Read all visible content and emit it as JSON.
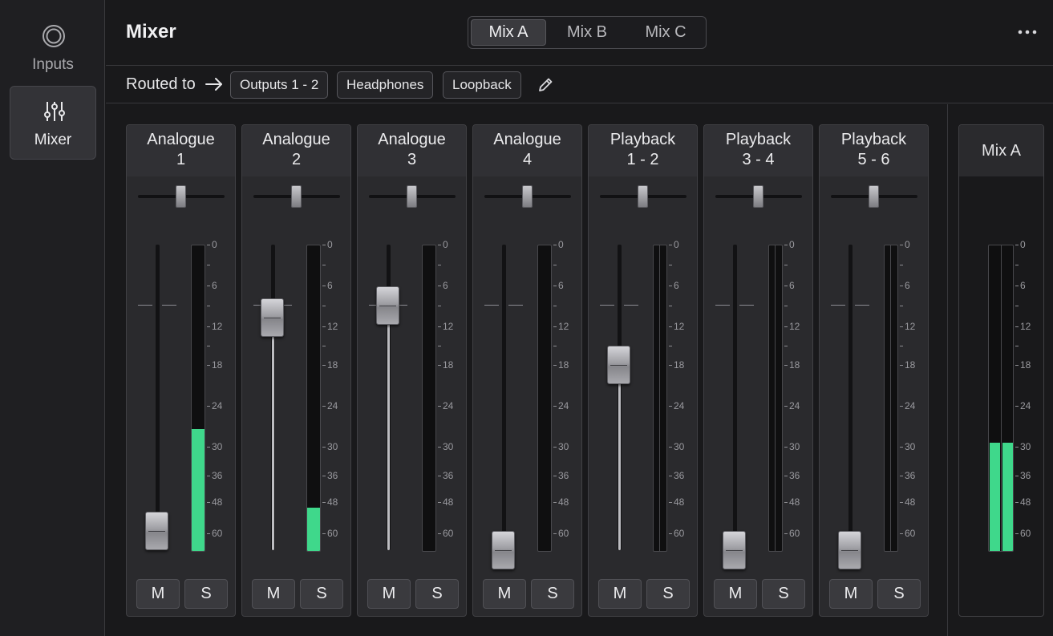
{
  "sidebar": {
    "items": [
      {
        "label": "Inputs",
        "icon": "inputs-icon",
        "active": false
      },
      {
        "label": "Mixer",
        "icon": "mixer-sliders-icon",
        "active": true
      }
    ]
  },
  "header": {
    "title": "Mixer",
    "tabs": [
      {
        "label": "Mix A",
        "active": true
      },
      {
        "label": "Mix B",
        "active": false
      },
      {
        "label": "Mix C",
        "active": false
      }
    ],
    "more_label": "•••"
  },
  "routing": {
    "label": "Routed to",
    "outputs": [
      "Outputs 1 - 2",
      "Headphones",
      "Loopback"
    ]
  },
  "scale_labels": [
    "0",
    "-",
    "6",
    "-",
    "12",
    "-",
    "18",
    "24",
    "30",
    "36",
    "48",
    "60"
  ],
  "channels": [
    {
      "line1": "Analogue",
      "line2": "1",
      "pan": 0.5,
      "fader_db": -24,
      "meter_db": -26,
      "stereo": false,
      "mute": "M",
      "solo": "S"
    },
    {
      "line1": "Analogue",
      "line2": "2",
      "pan": 0.5,
      "fader_db": -2,
      "meter_db": -46,
      "stereo": false,
      "mute": "M",
      "solo": "S"
    },
    {
      "line1": "Analogue",
      "line2": "3",
      "pan": 0.5,
      "fader_db": 0,
      "meter_db": null,
      "stereo": false,
      "mute": "M",
      "solo": "S"
    },
    {
      "line1": "Analogue",
      "line2": "4",
      "pan": 0.5,
      "fader_db": -100,
      "meter_db": null,
      "stereo": false,
      "mute": "M",
      "solo": "S"
    },
    {
      "line1": "Playback",
      "line2": "1 - 2",
      "pan": 0.5,
      "fader_db": -10,
      "meter_db": null,
      "stereo": true,
      "mute": "M",
      "solo": "S"
    },
    {
      "line1": "Playback",
      "line2": "3 - 4",
      "pan": 0.5,
      "fader_db": -100,
      "meter_db": null,
      "stereo": true,
      "mute": "M",
      "solo": "S"
    },
    {
      "line1": "Playback",
      "line2": "5 - 6",
      "pan": 0.5,
      "fader_db": -100,
      "meter_db": null,
      "stereo": true,
      "mute": "M",
      "solo": "S"
    }
  ],
  "master": {
    "label": "Mix A",
    "meter_db": -28
  },
  "colors": {
    "meter": "#3fd88b",
    "background": "#19191b",
    "strip": "#2a2a2d"
  }
}
